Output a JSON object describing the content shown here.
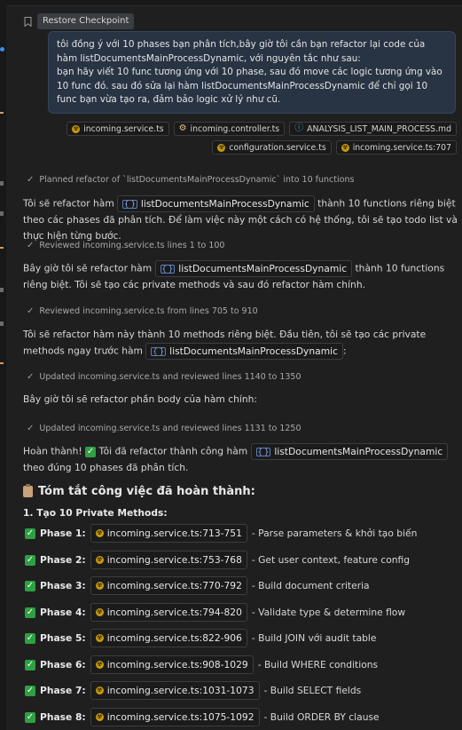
{
  "toolbar": {
    "restore_label": "Restore Checkpoint"
  },
  "user_message": {
    "line1": "tôi đồng ý với 10 phases bạn phân tích,bây giờ tôi cần bạn refactor lại code của hàm listDocumentsMainProcessDynamic, với nguyên tắc như sau:",
    "line2": "bạn hãy viết 10 func tương ứng với 10 phase, sau đó move các logic tương ứng vào 10 func đó. sau đó sửa lại hàm listDocumentsMainProcessDynamic để chỉ gọi 10 func bạn vừa tạo ra, đảm bảo logic xử lý như cũ."
  },
  "attachments": [
    {
      "label": "incoming.service.ts",
      "icon": "typescript-file-icon"
    },
    {
      "label": "incoming.controller.ts",
      "icon": "gear-icon"
    },
    {
      "label": "ANALYSIS_LIST_MAIN_PROCESS.md",
      "icon": "info-icon"
    },
    {
      "label": "configuration.service.ts",
      "icon": "typescript-file-icon"
    },
    {
      "label": "incoming.service.ts:707",
      "icon": "typescript-file-icon"
    }
  ],
  "steps": [
    "Planned refactor of `listDocumentsMainProcessDynamic` into 10 functions",
    "Reviewed incoming.service.ts lines 1 to 100",
    "Reviewed incoming.service.ts from lines 705 to 910",
    "Updated incoming.service.ts and reviewed lines 1140 to 1350",
    "Updated incoming.service.ts and reviewed lines 1131 to 1250"
  ],
  "paragraphs": {
    "p1_before": "Tôi sẽ refactor hàm",
    "p1_code": "listDocumentsMainProcessDynamic",
    "p1_after": "thành 10 functions riêng biệt theo các phases đã phân tích. Để làm việc này một cách có hệ thống, tôi sẽ tạo todo list và thực hiện từng bước.",
    "p2_before": "Bây giờ tôi sẽ refactor hàm",
    "p2_code": "listDocumentsMainProcessDynamic",
    "p2_after": "thành 10 functions riêng biệt. Tôi sẽ tạo các private methods và sau đó refactor hàm chính.",
    "p3_before": "Tôi sẽ refactor hàm này thành 10 methods riêng biệt. Đầu tiên, tôi sẽ tạo các private methods ngay trước hàm",
    "p3_code": "listDocumentsMainProcessDynamic",
    "p3_after": ":",
    "p4": "Bây giờ tôi sẽ refactor phần body của hàm chính:",
    "p5_before": "Hoàn thành!",
    "p5_middle": "Tôi đã refactor thành công hàm",
    "p5_code": "listDocumentsMainProcessDynamic",
    "p5_after": "theo đúng 10 phases đã phân tích."
  },
  "summary": {
    "title": "Tóm tắt công việc đã hoàn thành:",
    "section1": "1. Tạo 10 Private Methods:"
  },
  "phases": [
    {
      "label": "Phase 1:",
      "ref": "incoming.service.ts:713-751",
      "desc": "- Parse parameters & khởi tạo biến"
    },
    {
      "label": "Phase 2:",
      "ref": "incoming.service.ts:753-768",
      "desc": "- Get user context, feature config"
    },
    {
      "label": "Phase 3:",
      "ref": "incoming.service.ts:770-792",
      "desc": "- Build document criteria"
    },
    {
      "label": "Phase 4:",
      "ref": "incoming.service.ts:794-820",
      "desc": "- Validate type & determine flow"
    },
    {
      "label": "Phase 5:",
      "ref": "incoming.service.ts:822-906",
      "desc": "- Build JOIN với audit table"
    },
    {
      "label": "Phase 6:",
      "ref": "incoming.service.ts:908-1029",
      "desc": "- Build WHERE conditions"
    },
    {
      "label": "Phase 7:",
      "ref": "incoming.service.ts:1031-1073",
      "desc": "- Build SELECT fields"
    },
    {
      "label": "Phase 8:",
      "ref": "incoming.service.ts:1075-1092",
      "desc": "- Build ORDER BY clause"
    }
  ],
  "colors": {
    "background": "#1f1f1f",
    "user_bubble": "#283444",
    "accent_blue": "#3b8eea",
    "success_green": "#2ea043",
    "ts_icon": "#cc9a06"
  }
}
